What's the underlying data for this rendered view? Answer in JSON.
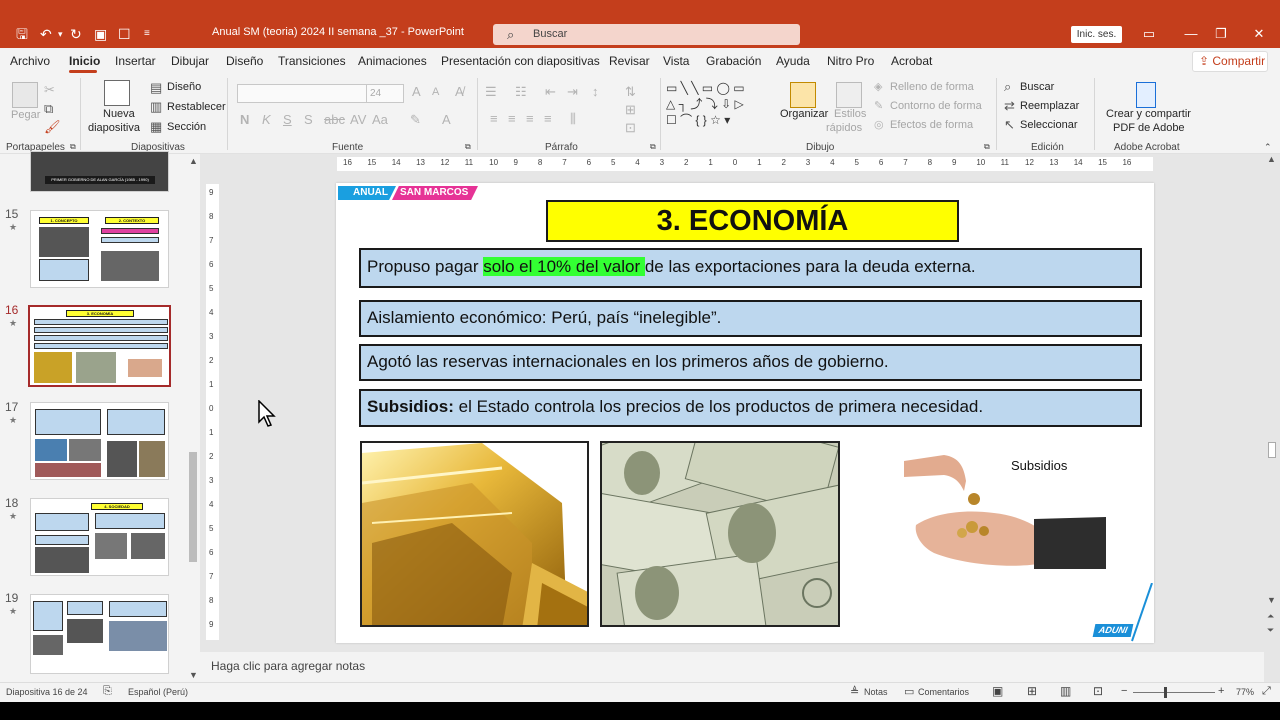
{
  "window": {
    "title": "Anual SM (teoria) 2024 II semana _37  -  PowerPoint",
    "search_placeholder": "Buscar",
    "signin_label": "Inic. ses.",
    "accent_color": "#C43E1C"
  },
  "menu": {
    "items": [
      "Archivo",
      "Inicio",
      "Insertar",
      "Dibujar",
      "Diseño",
      "Transiciones",
      "Animaciones",
      "Presentación con diapositivas",
      "Revisar",
      "Vista",
      "Grabación",
      "Ayuda",
      "Nitro Pro",
      "Acrobat"
    ],
    "active": "Inicio",
    "share_label": "Compartir"
  },
  "ribbon": {
    "portapapeles": {
      "paste_label": "Pegar",
      "group_label": "Portapapeles"
    },
    "diapositivas": {
      "new_slide_line1": "Nueva",
      "new_slide_line2": "diapositiva",
      "layout_label": "Diseño",
      "reset_label": "Restablecer",
      "section_label": "Sección",
      "group_label": "Diapositivas"
    },
    "fuente": {
      "font_size": "24",
      "group_label": "Fuente"
    },
    "parrafo": {
      "group_label": "Párrafo"
    },
    "dibujo": {
      "arrange_label": "Organizar",
      "styles_line1": "Estilos",
      "styles_line2": "rápidos",
      "fill_label": "Relleno de forma",
      "outline_label": "Contorno de forma",
      "effects_label": "Efectos de forma",
      "group_label": "Dibujo"
    },
    "edicion": {
      "find_label": "Buscar",
      "replace_label": "Reemplazar",
      "select_label": "Seleccionar",
      "group_label": "Edición"
    },
    "acrobat": {
      "create_line1": "Crear y compartir",
      "create_line2": "PDF de Adobe",
      "group_label": "Adobe Acrobat"
    }
  },
  "thumbnails": {
    "slide_numbers": [
      "15",
      "16",
      "17",
      "18",
      "19"
    ],
    "selected": "16",
    "thumb15": {
      "title1": "1. CONCEPTO",
      "title2": "2. CONTEXTO"
    },
    "thumb16": {
      "title": "3. ECONOMÍA"
    },
    "thumb18": {
      "title": "4. SOCIEDAD"
    },
    "thumb14_caption": "PRIMER GOBIERNO DE ALAN GARCÍA (1985 - 1990)"
  },
  "ruler": {
    "horizontal": [
      "16",
      "15",
      "14",
      "13",
      "12",
      "11",
      "10",
      "9",
      "8",
      "7",
      "6",
      "5",
      "4",
      "3",
      "2",
      "1",
      "0",
      "1",
      "2",
      "3",
      "4",
      "5",
      "6",
      "7",
      "8",
      "9",
      "10",
      "11",
      "12",
      "13",
      "14",
      "15",
      "16"
    ],
    "vertical": [
      "9",
      "8",
      "7",
      "6",
      "5",
      "4",
      "3",
      "2",
      "1",
      "0",
      "1",
      "2",
      "3",
      "4",
      "5",
      "6",
      "7",
      "8",
      "9"
    ]
  },
  "slide": {
    "tag_anual": "ANUAL",
    "tag_sanmarcos": "SAN MARCOS",
    "title": "3. ECONOMÍA",
    "box1": {
      "before": "Propuso pagar ",
      "highlight": "solo el 10% del valor ",
      "after": "de las exportaciones para la deuda externa."
    },
    "box2": "Aislamiento económico:  Perú, país “inelegible”.",
    "box3": "Agotó las reservas internacionales en los primeros años de gobierno.",
    "box4": {
      "bold": "Subsidios:",
      "rest": " el Estado controla los precios de los productos de primera necesidad."
    },
    "subsidios_caption": "Subsidios",
    "logo": "ADUNI",
    "colors": {
      "title_bg": "#FFFF00",
      "box_bg": "#BDD7EE",
      "highlight": "#33FF33",
      "tag_blue": "#1A9FE0",
      "tag_pink": "#E63396"
    }
  },
  "notes": {
    "placeholder": "Haga clic para agregar notas"
  },
  "status": {
    "slide_counter": "Diapositiva 16 de 24",
    "language": "Español (Perú)",
    "notes_label": "Notas",
    "comments_label": "Comentarios",
    "zoom": "77%",
    "zoom_level": 0.77
  }
}
